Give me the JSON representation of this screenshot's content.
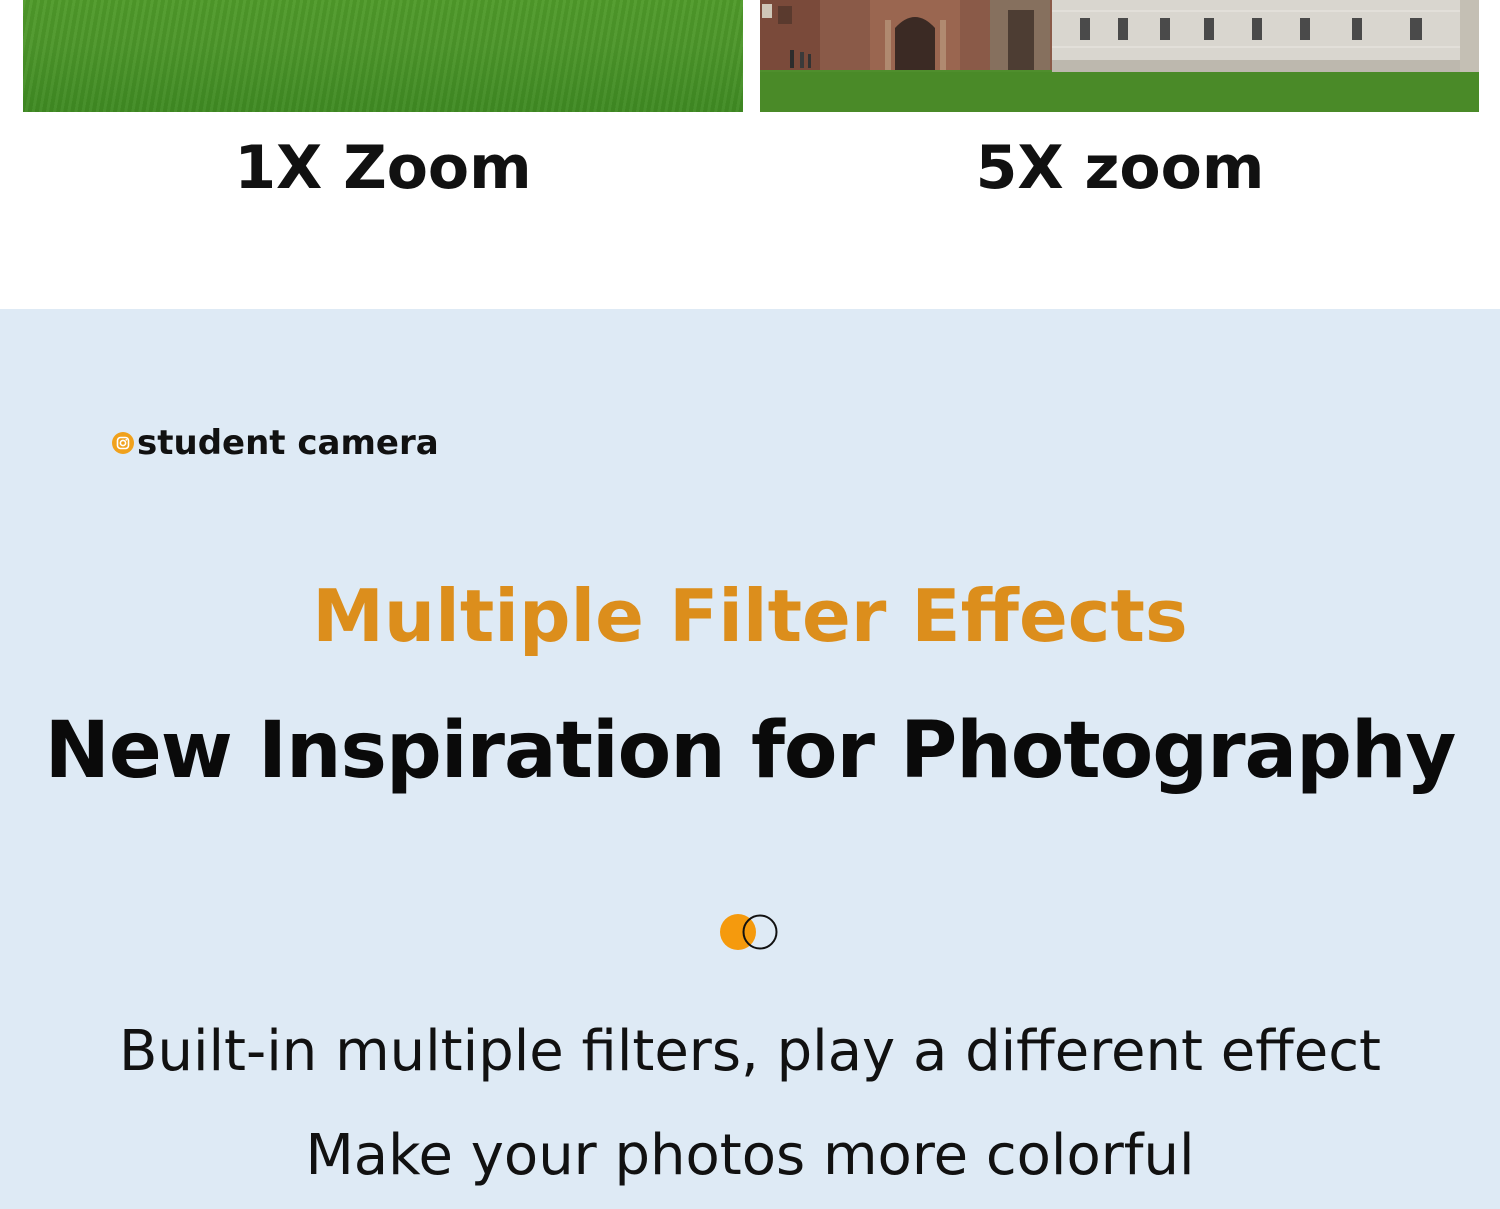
{
  "comparison": {
    "left": {
      "caption": "1X Zoom",
      "image": "wide lawn photo"
    },
    "right": {
      "caption": "5X zoom",
      "image": "zoomed building photo"
    }
  },
  "brand": {
    "icon": "camera-icon",
    "name": "student camera",
    "accent_color": "#f0a11c"
  },
  "headline": {
    "highlight": "Multiple Filter Effects",
    "title": "New Inspiration for Photography",
    "highlight_color": "#dc8e1c"
  },
  "description": {
    "line1": "Built-in multiple filters, play a different effect",
    "line2": "Make your photos more colorful"
  },
  "colors": {
    "section_background": "#deeaf5",
    "text": "#111111"
  }
}
